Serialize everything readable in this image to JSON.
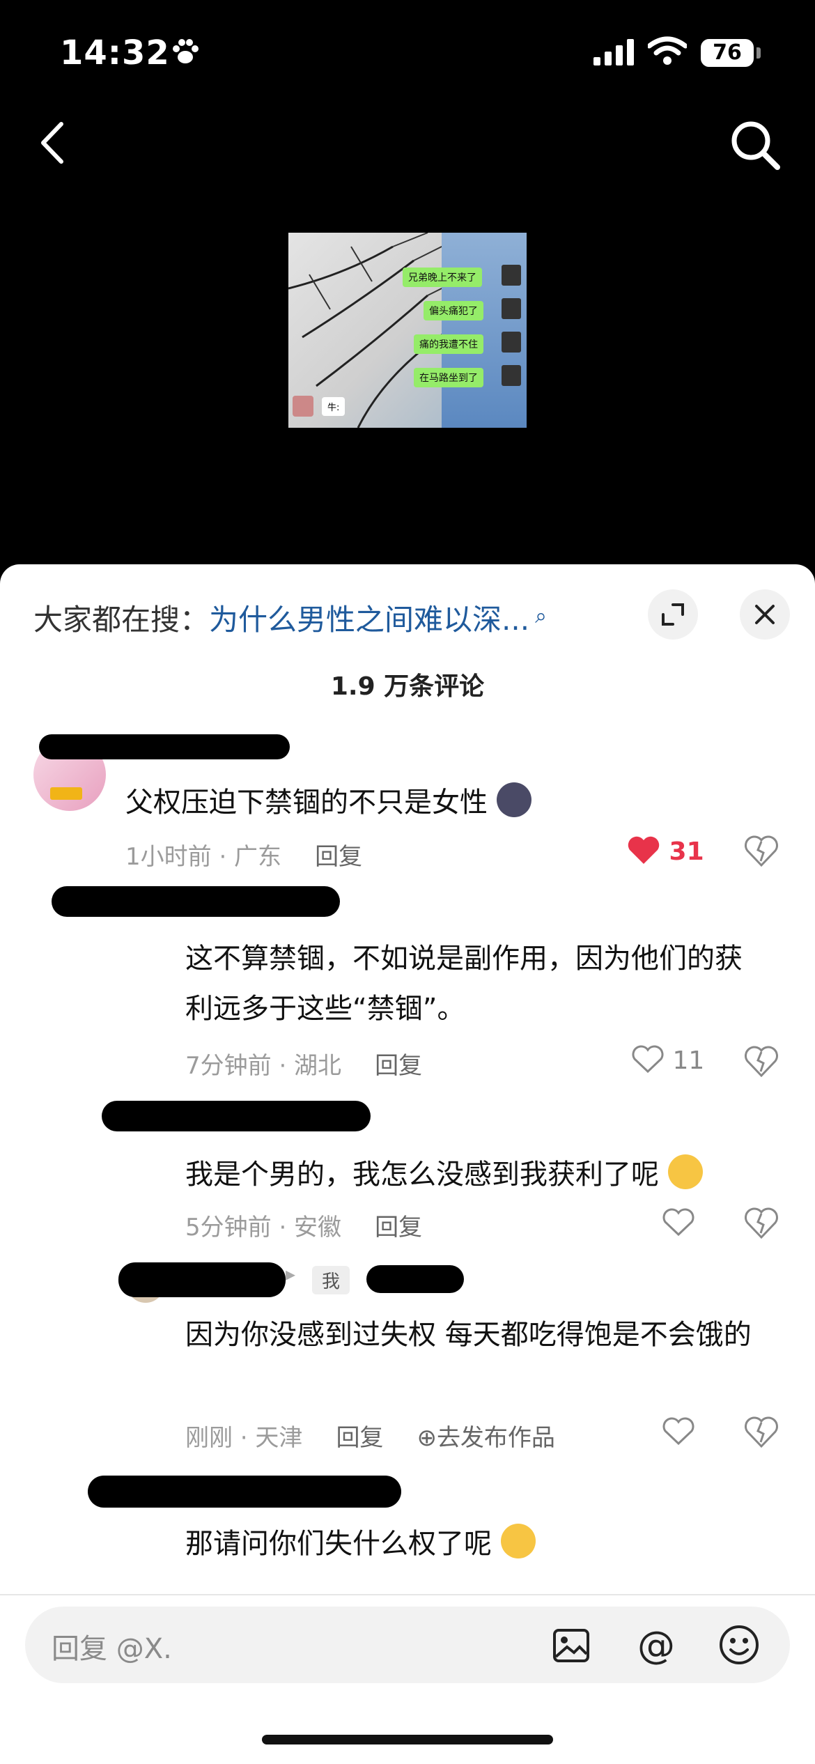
{
  "status_bar": {
    "time": "14:32",
    "battery": "76"
  },
  "video": {
    "chat_lines": [
      "兄弟晚上不来了",
      "偏头痛犯了",
      "痛的我遭不住",
      "在马路坐到了"
    ],
    "reply_line": "牛:"
  },
  "sheet": {
    "search_prefix": "大家都在搜：",
    "search_query": "为什么男性之间难以深...",
    "comment_count": "1.9 万条评论"
  },
  "comments": [
    {
      "text": "父权压迫下禁锢的不只是女性",
      "time_location": "1小时前 · 广东",
      "reply": "回复",
      "likes": "31"
    },
    {
      "text": "这不算禁锢，不如说是副作用，因为他们的获利远多于这些“禁锢”。",
      "time_location": "7分钟前 · 湖北",
      "reply": "回复",
      "likes": "11"
    },
    {
      "text": "我是个男的，我怎么没感到我获利了呢",
      "time_location": "5分钟前 · 安徽",
      "reply": "回复",
      "likes": ""
    },
    {
      "tag": "我",
      "text": "因为你没感到过失权 每天都吃得饱是不会饿的",
      "time_location": "刚刚 · 天津",
      "reply": "回复",
      "publish": "去发布作品",
      "likes": ""
    },
    {
      "text": "那请问你们失什么权了呢",
      "time_location": "",
      "reply": "",
      "likes": ""
    }
  ],
  "input": {
    "placeholder": "回复 @X."
  },
  "colors": {
    "accent_blue": "#1f5a9c",
    "like_red": "#e8334a",
    "bubble_green": "#95ec69"
  }
}
